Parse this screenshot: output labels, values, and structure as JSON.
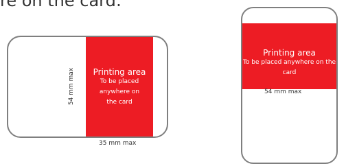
{
  "heading_fragment": "re on the card:",
  "landscape_card": {
    "print_area_title": "Printing area",
    "print_area_subtitle": "To be placed anywhere on the card",
    "height_label": "54 mm max",
    "width_label": "35 mm max"
  },
  "portrait_card": {
    "print_area_title": "Printing area",
    "print_area_subtitle": "To be placed anywhere on the card",
    "width_label": "54 mm max"
  },
  "colors": {
    "print_area": "#ed1c24",
    "card_border": "#7f7f7f"
  }
}
